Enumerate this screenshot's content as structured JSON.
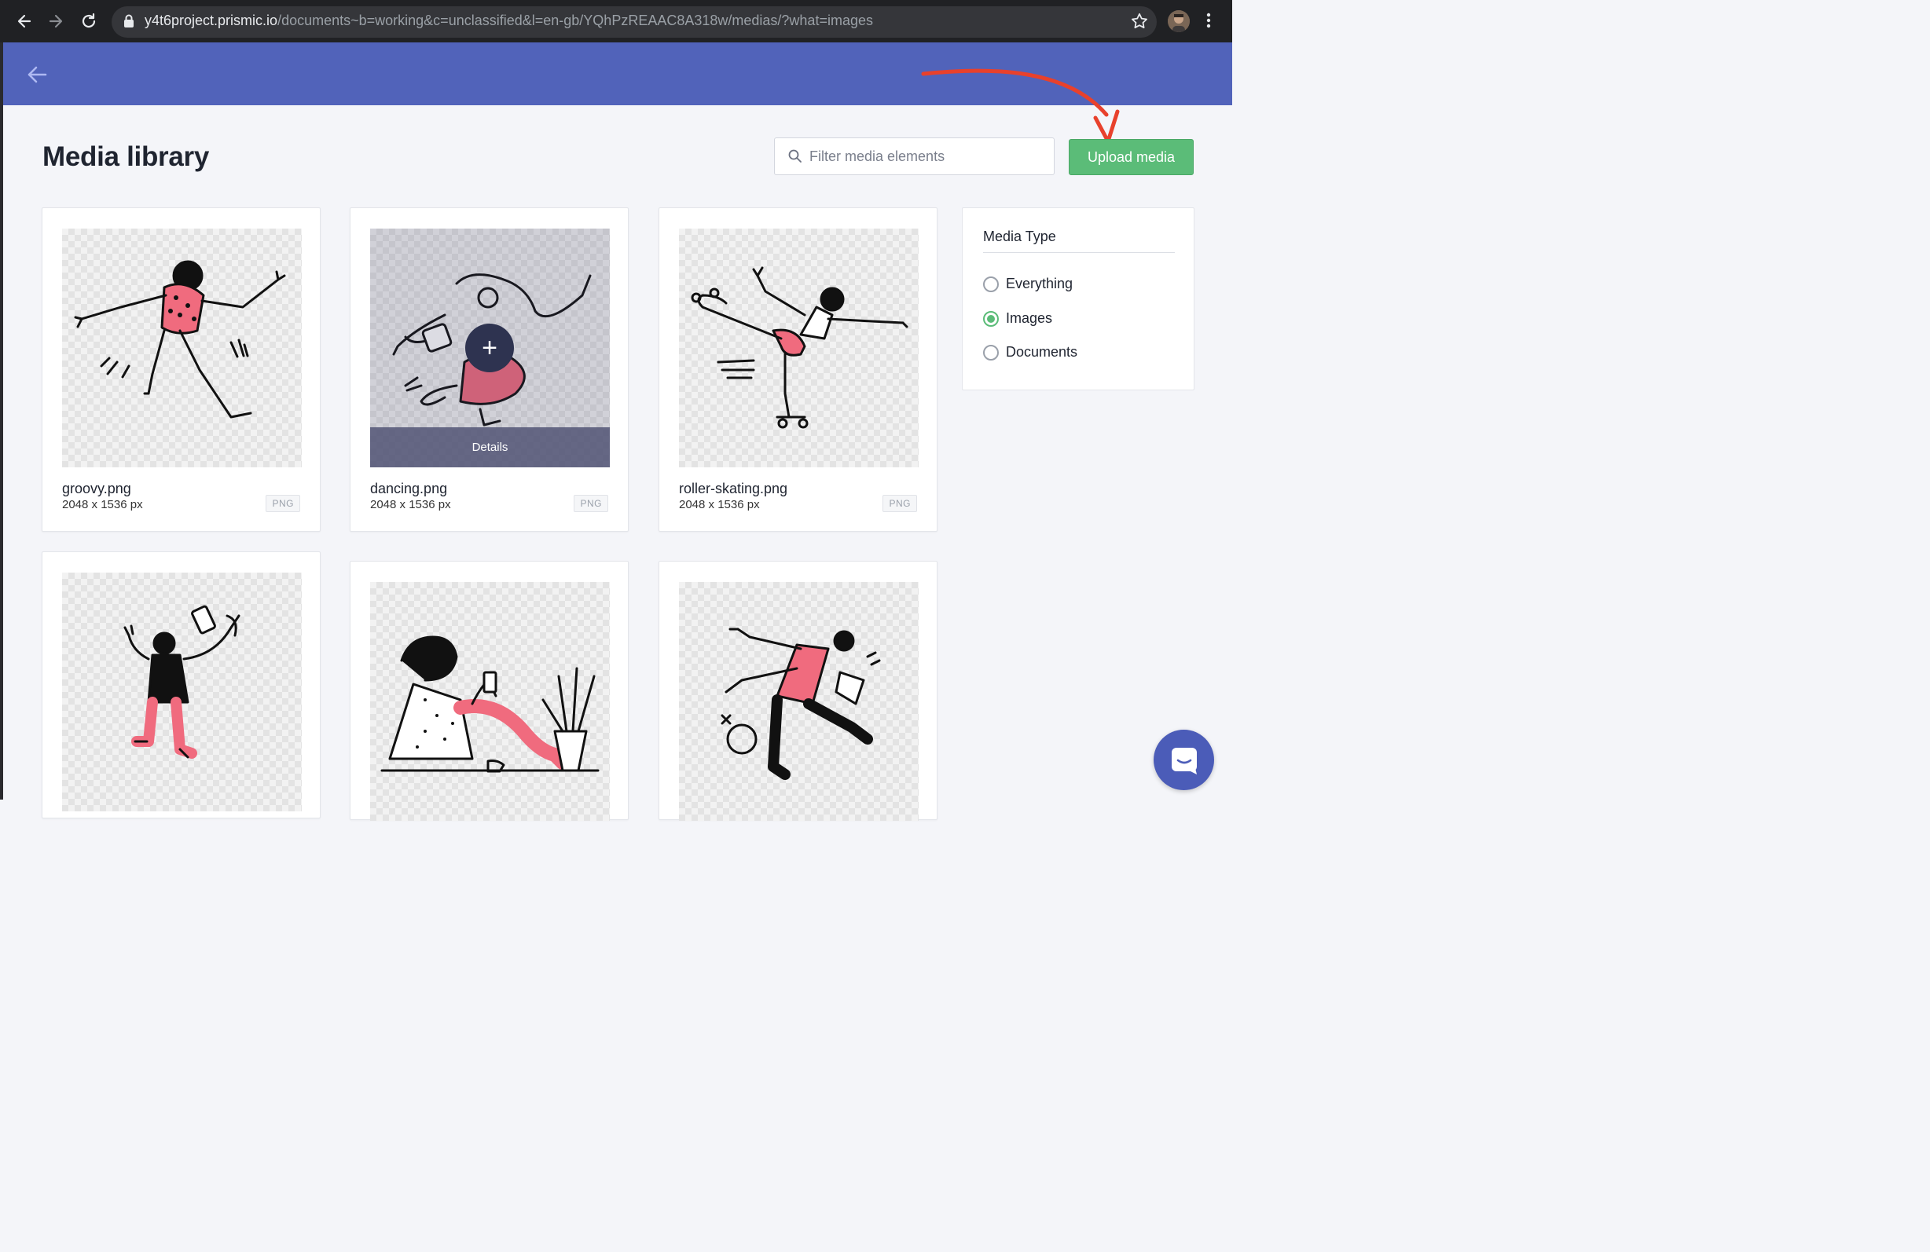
{
  "browser": {
    "url_host": "y4t6project.prismic.io",
    "url_path": "/documents~b=working&c=unclassified&l=en-gb/YQhPzREAAC8A318w/medias/?what=images"
  },
  "page": {
    "title": "Media library",
    "search_placeholder": "Filter media elements",
    "upload_label": "Upload media"
  },
  "media": [
    {
      "name": "groovy.png",
      "size": "2048 x 1536 px",
      "type": "PNG"
    },
    {
      "name": "dancing.png",
      "size": "2048 x 1536 px",
      "type": "PNG",
      "overlay_label": "Details",
      "overlay_action": "+"
    },
    {
      "name": "roller-skating.png",
      "size": "2048 x 1536 px",
      "type": "PNG"
    },
    {
      "name": "",
      "size": "",
      "type": ""
    },
    {
      "name": "",
      "size": "",
      "type": ""
    },
    {
      "name": "",
      "size": "",
      "type": ""
    }
  ],
  "filter": {
    "title": "Media Type",
    "options": [
      {
        "label": "Everything",
        "checked": false
      },
      {
        "label": "Images",
        "checked": true
      },
      {
        "label": "Documents",
        "checked": false
      }
    ]
  },
  "colors": {
    "header": "#5163ba",
    "accent": "#5bbc78",
    "annotation": "#e8412c"
  }
}
